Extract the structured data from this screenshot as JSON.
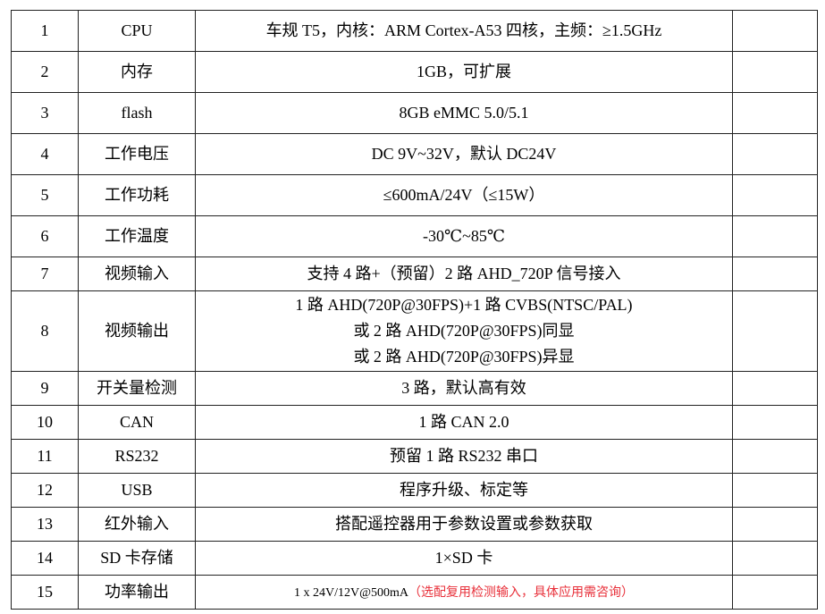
{
  "colors": {
    "text": "#000000",
    "note_red": "#e8303a",
    "border": "#222222"
  },
  "rows": [
    {
      "no": "1",
      "item": "CPU",
      "spec": "车规 T5，内核：ARM Cortex-A53  四核，主频：≥1.5GHz",
      "note": ""
    },
    {
      "no": "2",
      "item": "内存",
      "spec": "1GB，可扩展",
      "note": ""
    },
    {
      "no": "3",
      "item": "flash",
      "spec": "8GB eMMC 5.0/5.1",
      "note": ""
    },
    {
      "no": "4",
      "item": "工作电压",
      "spec": "DC 9V~32V，默认 DC24V",
      "note": ""
    },
    {
      "no": "5",
      "item": "工作功耗",
      "spec": "≤600mA/24V（≤15W）",
      "note": ""
    },
    {
      "no": "6",
      "item": "工作温度",
      "spec": "-30℃~85℃",
      "note": ""
    },
    {
      "no": "7",
      "item": "视频输入",
      "spec": "支持 4 路+（预留）2 路  AHD_720P 信号接入",
      "note": ""
    },
    {
      "no": "8",
      "item": "视频输出",
      "spec_lines": [
        "1 路 AHD(720P@30FPS)+1 路 CVBS(NTSC/PAL)",
        "或 2 路 AHD(720P@30FPS)同显",
        "或 2 路 AHD(720P@30FPS)异显"
      ],
      "note": ""
    },
    {
      "no": "9",
      "item": "开关量检测",
      "spec": "3 路，默认高有效",
      "note": ""
    },
    {
      "no": "10",
      "item": "CAN",
      "spec": "1 路 CAN 2.0",
      "note": ""
    },
    {
      "no": "11",
      "item": "RS232",
      "spec": "预留 1 路 RS232 串口",
      "note": ""
    },
    {
      "no": "12",
      "item": "USB",
      "spec": "程序升级、标定等",
      "note": ""
    },
    {
      "no": "13",
      "item": "红外输入",
      "spec": "搭配遥控器用于参数设置或参数获取",
      "note": ""
    },
    {
      "no": "14",
      "item": "SD 卡存储",
      "spec": "1×SD 卡",
      "note": ""
    },
    {
      "no": "15",
      "item": "功率输出",
      "spec": "1 x 24V/12V@500mA",
      "spec_red": "（选配复用检测输入，具体应用需咨询）",
      "note": ""
    }
  ]
}
